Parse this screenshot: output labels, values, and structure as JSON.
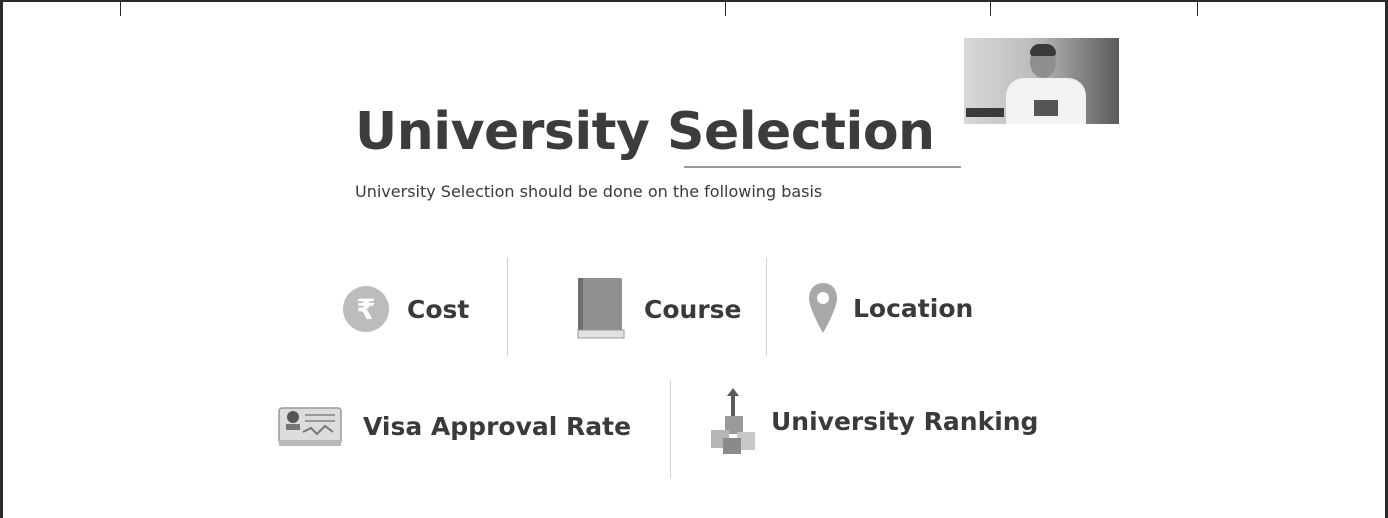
{
  "slide": {
    "title": "University Selection",
    "subtitle": "University Selection should be done on the following basis"
  },
  "criteria": [
    {
      "label": "Cost",
      "icon": "rupee-icon"
    },
    {
      "label": "Course",
      "icon": "book-icon"
    },
    {
      "label": "Location",
      "icon": "location-pin-icon"
    },
    {
      "label": "Visa Approval Rate",
      "icon": "visa-card-icon"
    },
    {
      "label": "University Ranking",
      "icon": "ranking-blocks-icon"
    }
  ],
  "colors": {
    "text": "#3a3a3a",
    "icon": "#a8a8a8",
    "divider": "#cfcfcf"
  }
}
